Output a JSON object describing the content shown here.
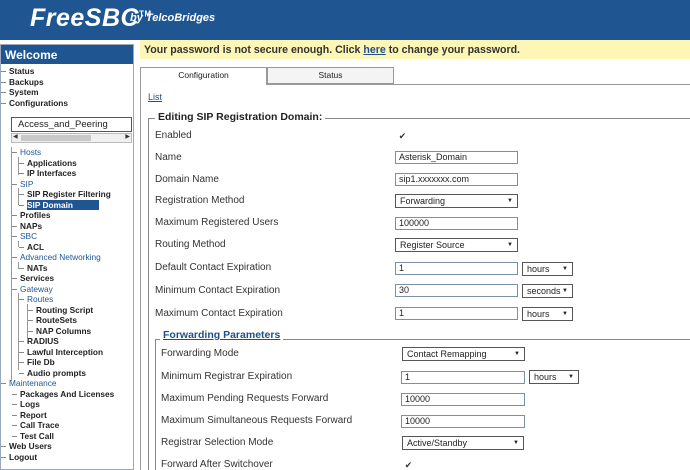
{
  "header": {
    "logo": "FreeSBC",
    "logo_tm": "TM",
    "logo_by": "by TelcoBridges"
  },
  "sidebar": {
    "welcome": "Welcome",
    "search_value": "Access_and_Peering",
    "items": [
      "Status",
      "Backups",
      "System",
      "Configurations",
      "Hosts",
      "Applications",
      "IP Interfaces",
      "SIP",
      "SIP Register Filtering",
      "SIP Domain",
      "Profiles",
      "NAPs",
      "SBC",
      "ACL",
      "Advanced Networking",
      "NATs",
      "Services",
      "Gateway",
      "Routes",
      "Routing Script",
      "RouteSets",
      "NAP Columns",
      "RADIUS",
      "Lawful Interception",
      "File Db",
      "Audio prompts",
      "Maintenance",
      "Packages And Licenses",
      "Logs",
      "Report",
      "Call Trace",
      "Test Call",
      "Web Users",
      "Logout"
    ]
  },
  "warning": {
    "before": "Your password is not secure enough. Click ",
    "link": "here",
    "after": " to change your password."
  },
  "tabs": [
    "Configuration",
    "Status"
  ],
  "list_link": "List",
  "form": {
    "legend": "Editing SIP Registration Domain:",
    "enabled_label": "Enabled",
    "name_label": "Name",
    "name_value": "Asterisk_Domain",
    "domain_label": "Domain Name",
    "domain_value": "sip1.xxxxxxx.com",
    "reg_method_label": "Registration Method",
    "reg_method_value": "Forwarding",
    "max_users_label": "Maximum Registered Users",
    "max_users_value": "100000",
    "routing_label": "Routing Method",
    "routing_value": "Register Source",
    "default_exp_label": "Default Contact Expiration",
    "default_exp_value": "1",
    "default_exp_unit": "hours",
    "min_exp_label": "Minimum Contact Expiration",
    "min_exp_value": "30",
    "min_exp_unit": "seconds",
    "max_exp_label": "Maximum Contact Expiration",
    "max_exp_value": "1",
    "max_exp_unit": "hours"
  },
  "forwarding": {
    "legend": "Forwarding Parameters",
    "mode_label": "Forwarding Mode",
    "mode_value": "Contact Remapping",
    "min_reg_label": "Minimum Registrar Expiration",
    "min_reg_value": "1",
    "min_reg_unit": "hours",
    "max_pending_label": "Maximum Pending Requests Forward",
    "max_pending_value": "10000",
    "max_simul_label": "Maximum Simultaneous Requests Forward",
    "max_simul_value": "10000",
    "registrar_mode_label": "Registrar Selection Mode",
    "registrar_mode_value": "Active/Standby",
    "after_switch_label": "Forward After Switchover"
  },
  "icons": {
    "dropdown": "chevron-down-icon",
    "checkbox": "checkmark-icon"
  },
  "colors": {
    "brand": "#1f5692",
    "warning_bg": "#fdf6b4"
  }
}
